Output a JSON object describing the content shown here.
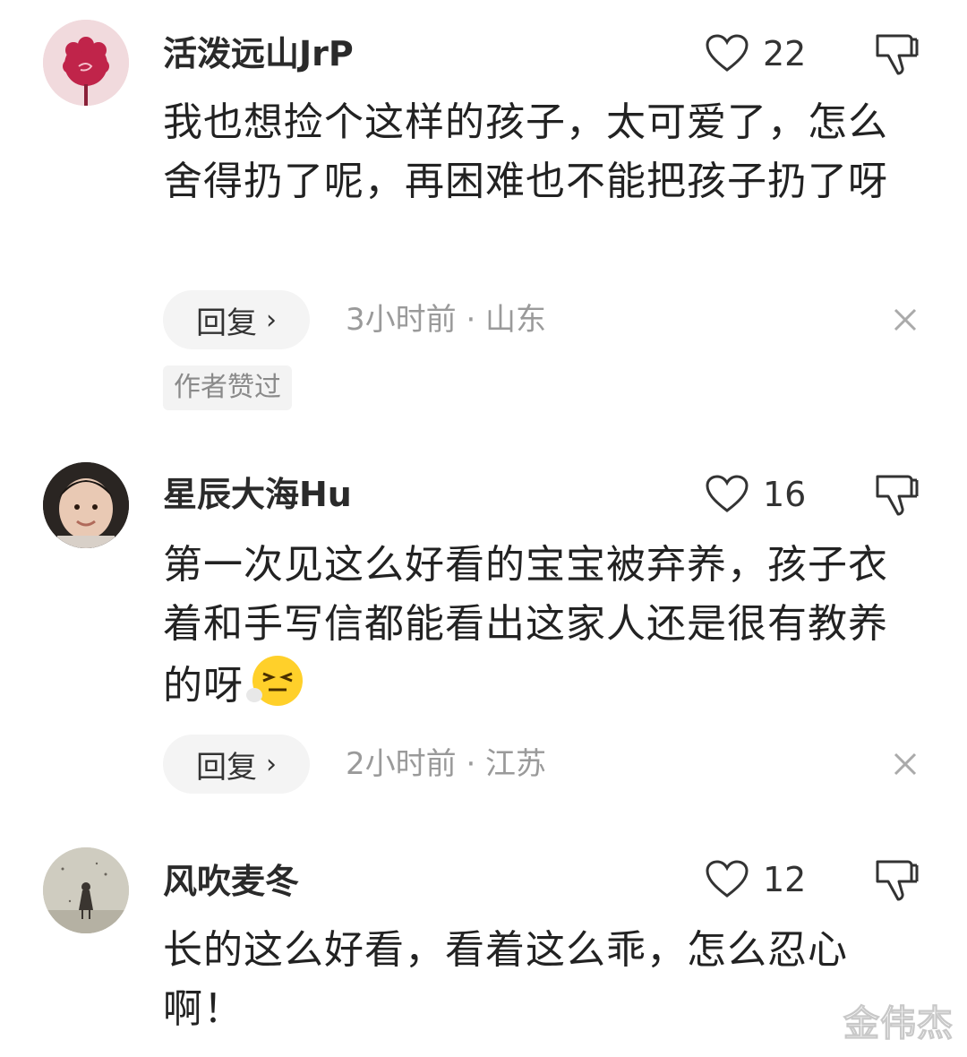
{
  "comments": [
    {
      "username": "活泼远山JrP",
      "likes": "22",
      "text": "我也想捡个这样的孩子，太可爱了，怎么舍得扔了呢，再困难也不能把孩子扔了呀",
      "reply_label": "回复",
      "meta": "3小时前 · 山东",
      "author_badge": "作者赞过",
      "avatar": "pink-flower-avatar"
    },
    {
      "username": "星辰大海Hu",
      "likes": "16",
      "text": "第一次见这么好看的宝宝被弃养，孩子衣着和手写信都能看出这家人还是很有教养的呀",
      "emoji": "squinting-face-emoji",
      "reply_label": "回复",
      "meta": "2小时前 · 江苏",
      "avatar": "baby-photo-avatar"
    },
    {
      "username": "风吹麦冬",
      "likes": "12",
      "text": "长的这么好看，看着这么乖，怎么忍心啊！",
      "avatar": "girl-silhouette-avatar"
    }
  ],
  "watermark": "金伟杰",
  "icons": {
    "like": "heart-outline-icon",
    "dislike": "thumbs-down-icon",
    "close": "close-icon",
    "chevron": "chevron-right-icon"
  },
  "colors": {
    "text": "#222222",
    "meta": "#9a9a9a",
    "chip_bg": "#f4f4f4"
  }
}
